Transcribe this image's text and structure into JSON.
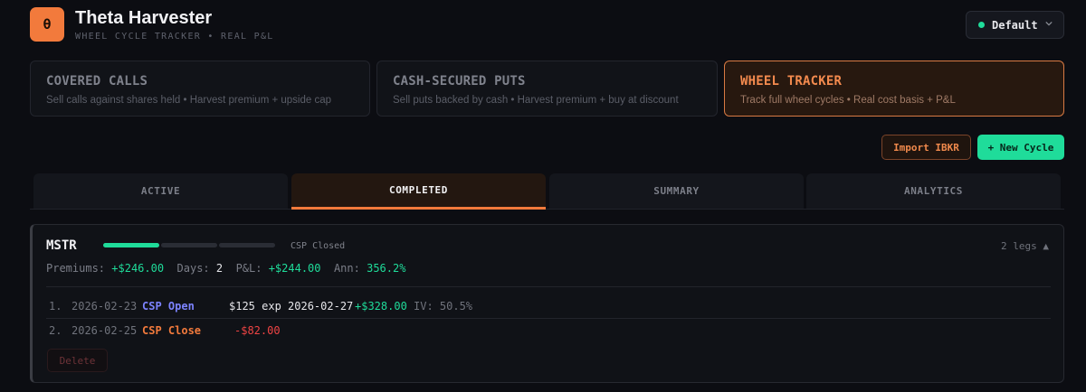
{
  "header": {
    "logo_glyph": "θ",
    "title": "Theta Harvester",
    "subtitle": "WHEEL CYCLE TRACKER • REAL P&L",
    "profile_label": "Default"
  },
  "strategies": [
    {
      "title": "COVERED CALLS",
      "desc": "Sell calls against shares held • Harvest premium + upside cap"
    },
    {
      "title": "CASH-SECURED PUTS",
      "desc": "Sell puts backed by cash • Harvest premium + buy at discount"
    },
    {
      "title": "WHEEL TRACKER",
      "desc": "Track full wheel cycles • Real cost basis + P&L"
    }
  ],
  "actions": {
    "import": "Import IBKR",
    "new_cycle": "+ New Cycle"
  },
  "tabs": [
    "ACTIVE",
    "COMPLETED",
    "SUMMARY",
    "ANALYTICS"
  ],
  "cycle": {
    "ticker": "MSTR",
    "status": "CSP Closed",
    "legs_count": "2 legs ▲",
    "premiums_label": "Premiums:",
    "premiums": "+$246.00",
    "days_label": "Days:",
    "days": "2",
    "pl_label": "P&L:",
    "pl": "+$244.00",
    "ann_label": "Ann:",
    "ann": "356.2%",
    "legs": [
      {
        "num": "1.",
        "date": "2026-02-23",
        "type": "CSP Open",
        "detail": "$125 exp 2026-02-27",
        "amount": "+$328.00",
        "iv": "IV: 50.5%"
      },
      {
        "num": "2.",
        "date": "2026-02-25",
        "type": "CSP Close",
        "detail": "",
        "amount": "-$82.00",
        "iv": ""
      }
    ],
    "delete_label": "Delete"
  },
  "colors": {
    "accent": "#f27a3c",
    "positive": "#1fdc9a",
    "negative": "#ef4444",
    "open": "#7c83ff"
  }
}
